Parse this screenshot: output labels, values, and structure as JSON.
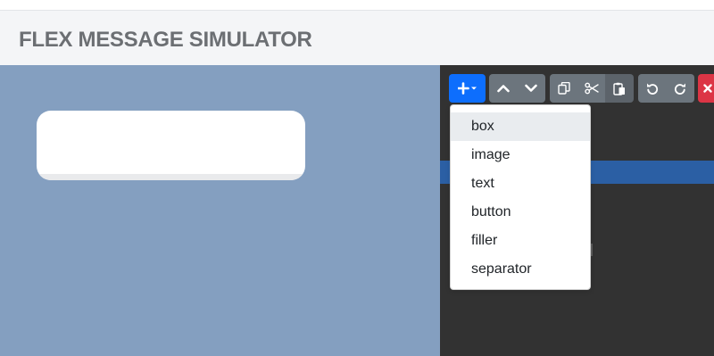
{
  "app": {
    "title": "FLEX MESSAGE SIMULATOR"
  },
  "colors": {
    "preview_bg": "#849fc0",
    "editor_bg": "#323232",
    "primary": "#0d6efd",
    "secondary": "#6c757d",
    "danger": "#dc3545",
    "selection": "#2b5fa4"
  },
  "toolbar": {
    "buttons": [
      {
        "name": "add-component-button",
        "icon": "plus-caret-icon"
      },
      {
        "name": "move-up-button",
        "icon": "chevron-up-icon"
      },
      {
        "name": "move-down-button",
        "icon": "chevron-down-icon"
      },
      {
        "name": "copy-button",
        "icon": "copy-icon"
      },
      {
        "name": "cut-button",
        "icon": "scissors-icon"
      },
      {
        "name": "paste-button",
        "icon": "clipboard-icon"
      },
      {
        "name": "undo-button",
        "icon": "undo-icon"
      },
      {
        "name": "redo-button",
        "icon": "redo-icon"
      },
      {
        "name": "delete-button",
        "icon": "close-icon"
      }
    ]
  },
  "add_menu": {
    "items": [
      "box",
      "image",
      "text",
      "button",
      "filler",
      "separator"
    ],
    "hovered": "box"
  }
}
